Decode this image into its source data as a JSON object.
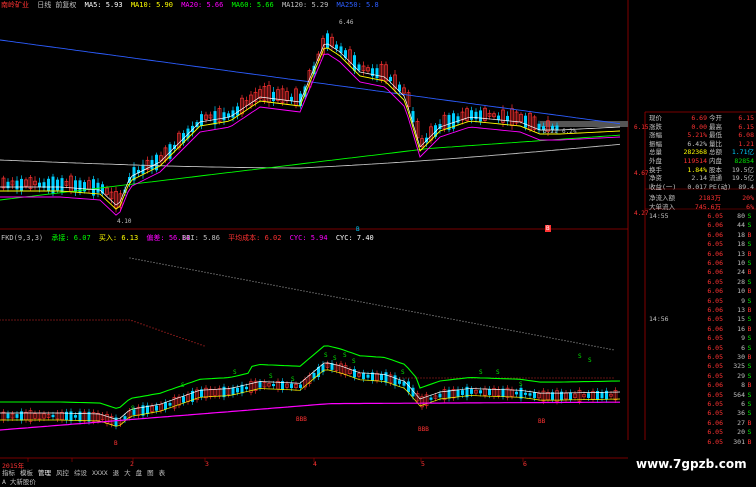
{
  "top_legend": {
    "title": "南岭矿业",
    "mode": "日线 前复权",
    "mas": [
      {
        "label": "MA5: 5.93",
        "color": "#ffffff"
      },
      {
        "label": "MA10: 5.90",
        "color": "#ffff00"
      },
      {
        "label": "MA20: 5.66",
        "color": "#ff00ff"
      },
      {
        "label": "MA60: 5.66",
        "color": "#00ff00"
      },
      {
        "label": "MA120: 5.29",
        "color": "#c0c0c0"
      },
      {
        "label": "MA250: 5.8",
        "color": "#2c5dff"
      }
    ]
  },
  "price_annotations": {
    "high": "6.46",
    "low": "4.10",
    "current": "6.21",
    "pct": "6.2%"
  },
  "axis_labels": [
    {
      "label": "6.15",
      "color": "#ff3232"
    },
    {
      "label": "4.67",
      "color": "#ff3232"
    },
    {
      "label": "4.27",
      "color": "#ff3232"
    }
  ],
  "indicator_legend": {
    "title": "FKD(9,3,3)",
    "items": [
      {
        "label": "承接: 6.07",
        "color": "#00ff00"
      },
      {
        "label": "买入: 6.13",
        "color": "#ffff00"
      },
      {
        "label": "偏差: 56.14",
        "color": "#ff00ff"
      }
    ]
  },
  "indicator2_legend": {
    "items": [
      {
        "label": "BBI: 5.86",
        "color": "#c0c0c0"
      },
      {
        "label": "平均成本: 6.02",
        "color": "#ff3232"
      },
      {
        "label": "CYC: 5.94",
        "color": "#ff00ff"
      },
      {
        "label": "CYC: 7.40",
        "color": "#ffffff"
      }
    ]
  },
  "signals": {
    "s": "S",
    "b": "B",
    "bb": "BBB",
    "bb2": "BB"
  },
  "quote": {
    "rows": [
      {
        "l1": "现价",
        "v1": "6.69",
        "c1": "#ff3232",
        "l2": "今开",
        "v2": "6.15",
        "c2": "#ff3232"
      },
      {
        "l1": "涨跌",
        "v1": "0.00",
        "c1": "#ff3232",
        "l2": "最高",
        "v2": "6.15",
        "c2": "#ff3232"
      },
      {
        "l1": "涨幅",
        "v1": "5.21%",
        "c1": "#ff3232",
        "l2": "最低",
        "v2": "6.08",
        "c2": "#ff3232"
      },
      {
        "l1": "振幅",
        "v1": "6.42%",
        "c1": "#c0c0c0",
        "l2": "量比",
        "v2": "1.21",
        "c2": "#ff3232"
      },
      {
        "l1": "总量",
        "v1": "282368",
        "c1": "#ffff00",
        "l2": "总额",
        "v2": "1.71亿",
        "c2": "#00d0ff"
      },
      {
        "l1": "外盘",
        "v1": "119514",
        "c1": "#ff3232",
        "l2": "内盘",
        "v2": "82854",
        "c2": "#00e000"
      },
      {
        "l1": "换手",
        "v1": "1.84%",
        "c1": "#ffff00",
        "l2": "股本",
        "v2": "19.5亿",
        "c2": "#c0c0c0"
      },
      {
        "l1": "净资",
        "v1": "2.14",
        "c1": "#c0c0c0",
        "l2": "流通",
        "v2": "19.5亿",
        "c2": "#c0c0c0"
      },
      {
        "l1": "收益(一)",
        "v1": "0.017",
        "c1": "#c0c0c0",
        "l2": "PE(动)",
        "v2": "89.4",
        "c2": "#c0c0c0"
      }
    ],
    "flow": [
      {
        "l1": "净流入额",
        "v1": "2183万",
        "c1": "#ff3232",
        "v2": "20%",
        "c2": "#ff3232"
      },
      {
        "l1": "大单流入",
        "v1": "745.6万",
        "c1": "#ff3232",
        "v2": "6%",
        "c2": "#ff3232"
      }
    ]
  },
  "ticks": [
    {
      "t": "14:55",
      "p": "6.05",
      "v": "80",
      "d": "S"
    },
    {
      "t": "",
      "p": "6.06",
      "v": "44",
      "d": "S"
    },
    {
      "t": "",
      "p": "6.06",
      "v": "18",
      "d": "B"
    },
    {
      "t": "",
      "p": "6.05",
      "v": "18",
      "d": "S"
    },
    {
      "t": "",
      "p": "6.06",
      "v": "13",
      "d": "B"
    },
    {
      "t": "",
      "p": "6.06",
      "v": "10",
      "d": "S"
    },
    {
      "t": "",
      "p": "6.06",
      "v": "24",
      "d": "B"
    },
    {
      "t": "",
      "p": "6.05",
      "v": "28",
      "d": "S"
    },
    {
      "t": "",
      "p": "6.06",
      "v": "10",
      "d": "B"
    },
    {
      "t": "",
      "p": "6.05",
      "v": "9",
      "d": "S"
    },
    {
      "t": "",
      "p": "6.06",
      "v": "13",
      "d": "B"
    },
    {
      "t": "14:56",
      "p": "6.05",
      "v": "15",
      "d": "S"
    },
    {
      "t": "",
      "p": "6.06",
      "v": "16",
      "d": "B"
    },
    {
      "t": "",
      "p": "6.05",
      "v": "9",
      "d": "S"
    },
    {
      "t": "",
      "p": "6.05",
      "v": "6",
      "d": "S"
    },
    {
      "t": "",
      "p": "6.05",
      "v": "30",
      "d": "B"
    },
    {
      "t": "",
      "p": "6.05",
      "v": "325",
      "d": "S"
    },
    {
      "t": "",
      "p": "6.05",
      "v": "29",
      "d": "S"
    },
    {
      "t": "",
      "p": "6.06",
      "v": "8",
      "d": "B"
    },
    {
      "t": "",
      "p": "6.05",
      "v": "564",
      "d": "S"
    },
    {
      "t": "",
      "p": "6.05",
      "v": "6",
      "d": "S"
    },
    {
      "t": "",
      "p": "6.05",
      "v": "36",
      "d": "S"
    },
    {
      "t": "",
      "p": "6.06",
      "v": "27",
      "d": "B"
    },
    {
      "t": "",
      "p": "6.05",
      "v": "20",
      "d": "S"
    },
    {
      "t": "",
      "p": "6.05",
      "v": "301",
      "d": "B"
    }
  ],
  "markers": {
    "m1": "B",
    "m2": "B"
  },
  "bottom": {
    "year": "2015年",
    "xticks": [
      "2",
      "3",
      "4",
      "5",
      "6"
    ],
    "tabs": [
      {
        "label": "指标",
        "active": false
      },
      {
        "label": "模板",
        "active": false
      },
      {
        "label": "管理",
        "active": true
      },
      {
        "label": "风控",
        "active": false
      },
      {
        "label": "综设",
        "active": false
      },
      {
        "label": "XXXX",
        "active": false
      },
      {
        "label": "退",
        "active": false
      },
      {
        "label": "大",
        "active": false
      },
      {
        "label": "盘",
        "active": false
      },
      {
        "label": "图",
        "active": false
      },
      {
        "label": "表",
        "active": false
      }
    ],
    "status": "A 大新股价"
  },
  "watermark": "www.7gpzb.com"
}
